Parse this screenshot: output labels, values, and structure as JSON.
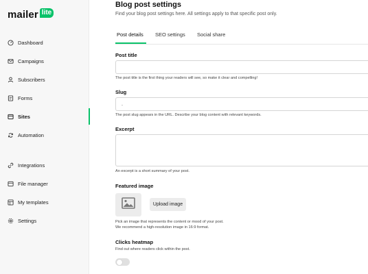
{
  "brand": {
    "name": "mailer",
    "badge": "lite",
    "accent": "#09c269"
  },
  "sidebar": {
    "items": [
      {
        "label": "Dashboard",
        "icon": "dashboard-icon"
      },
      {
        "label": "Campaigns",
        "icon": "mail-icon"
      },
      {
        "label": "Subscribers",
        "icon": "user-icon"
      },
      {
        "label": "Forms",
        "icon": "forms-icon"
      },
      {
        "label": "Sites",
        "icon": "sites-icon",
        "active": true
      },
      {
        "label": "Automation",
        "icon": "refresh-icon"
      },
      {
        "label": "Integrations",
        "icon": "link-icon"
      },
      {
        "label": "File manager",
        "icon": "file-icon"
      },
      {
        "label": "My templates",
        "icon": "template-icon"
      },
      {
        "label": "Settings",
        "icon": "gear-icon"
      }
    ]
  },
  "page": {
    "title": "Blog post settings",
    "subtitle": "Find your blog post settings here. All settings apply to that specific post only."
  },
  "tabs": [
    {
      "label": "Post details",
      "active": true
    },
    {
      "label": "SEO settings"
    },
    {
      "label": "Social share"
    }
  ],
  "fields": {
    "post_title": {
      "label": "Post title",
      "value": "",
      "help": "The post title is the first thing your readers will see, so make it clear and compelling!"
    },
    "slug": {
      "label": "Slug",
      "value": ".",
      "help": "The post slug appears in the URL. Describe your blog content with relevant keywords."
    },
    "excerpt": {
      "label": "Excerpt",
      "value": "",
      "help": "An excerpt is a short summary of your post."
    },
    "featured_image": {
      "label": "Featured image",
      "button": "Upload image",
      "help_line1": "Pick an image that represents the content or mood of your post.",
      "help_line2": "We recommend a high-resolution image in 16:9 format."
    },
    "clicks_heatmap": {
      "label": "Clicks heatmap",
      "help": "Find out where readers click within the post.",
      "enabled": false
    }
  }
}
